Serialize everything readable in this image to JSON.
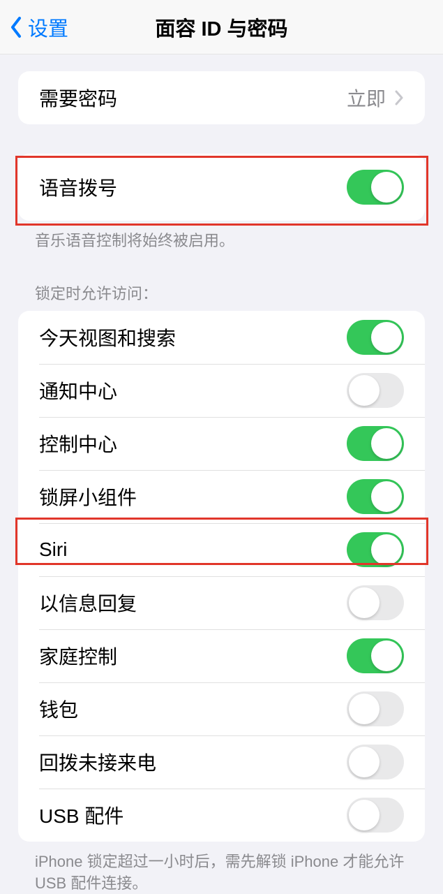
{
  "nav": {
    "back_label": "设置",
    "title": "面容 ID 与密码"
  },
  "group_passcode": {
    "require_passcode_label": "需要密码",
    "require_passcode_value": "立即"
  },
  "group_voice": {
    "voice_dial_label": "语音拨号",
    "voice_dial_on": true,
    "footer": "音乐语音控制将始终被启用。"
  },
  "group_lock": {
    "header": "锁定时允许访问：",
    "items": [
      {
        "label": "今天视图和搜索",
        "on": true
      },
      {
        "label": "通知中心",
        "on": false
      },
      {
        "label": "控制中心",
        "on": true
      },
      {
        "label": "锁屏小组件",
        "on": true
      },
      {
        "label": "Siri",
        "on": true
      },
      {
        "label": "以信息回复",
        "on": false
      },
      {
        "label": "家庭控制",
        "on": true
      },
      {
        "label": "钱包",
        "on": false
      },
      {
        "label": "回拨未接来电",
        "on": false
      },
      {
        "label": "USB 配件",
        "on": false
      }
    ],
    "footer": "iPhone 锁定超过一小时后，需先解锁 iPhone 才能允许 USB 配件连接。"
  }
}
